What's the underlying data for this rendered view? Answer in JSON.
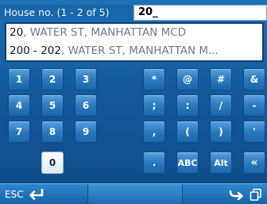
{
  "header": {
    "label": "House no. (1 - 2 of 5)",
    "input_value": "20_"
  },
  "results": [
    {
      "number": "20",
      "rest": ", WATER ST, MANHATTAN MCD"
    },
    {
      "number": "200 - 202",
      "rest": ", WATER ST, MANHATTAN M..."
    }
  ],
  "keys": {
    "digits": [
      "1",
      "2",
      "3",
      "4",
      "5",
      "6",
      "7",
      "8",
      "9",
      "0"
    ],
    "symbols": [
      "*",
      "@",
      "#",
      "&",
      ";",
      ":",
      "/",
      "-",
      ",",
      "(",
      ")",
      "'",
      "."
    ],
    "abc": "ABC",
    "alt": "Alt",
    "backspace": "«"
  },
  "bottom": {
    "esc_label": "ESC"
  },
  "colors": {
    "background": "#15599a",
    "key_blue": "#2b79bf",
    "input_bg": "#ffffff"
  },
  "icons": {
    "esc": "back-arrow-icon",
    "next": "forward-arrow-icon",
    "keyboard": "keyboard-switch-icon"
  }
}
